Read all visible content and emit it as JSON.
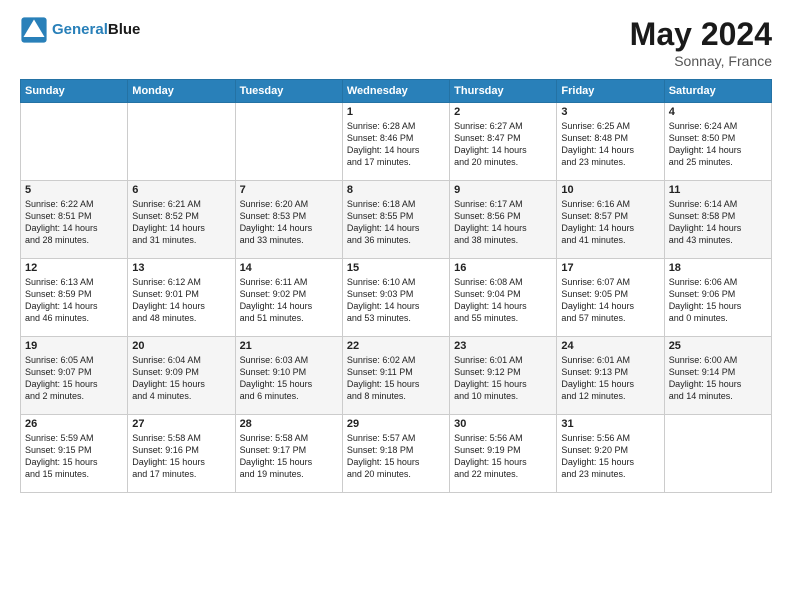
{
  "header": {
    "logo_line1": "General",
    "logo_line2": "Blue",
    "month_year": "May 2024",
    "location": "Sonnay, France"
  },
  "days_of_week": [
    "Sunday",
    "Monday",
    "Tuesday",
    "Wednesday",
    "Thursday",
    "Friday",
    "Saturday"
  ],
  "weeks": [
    [
      {
        "day": "",
        "info": ""
      },
      {
        "day": "",
        "info": ""
      },
      {
        "day": "",
        "info": ""
      },
      {
        "day": "1",
        "info": "Sunrise: 6:28 AM\nSunset: 8:46 PM\nDaylight: 14 hours\nand 17 minutes."
      },
      {
        "day": "2",
        "info": "Sunrise: 6:27 AM\nSunset: 8:47 PM\nDaylight: 14 hours\nand 20 minutes."
      },
      {
        "day": "3",
        "info": "Sunrise: 6:25 AM\nSunset: 8:48 PM\nDaylight: 14 hours\nand 23 minutes."
      },
      {
        "day": "4",
        "info": "Sunrise: 6:24 AM\nSunset: 8:50 PM\nDaylight: 14 hours\nand 25 minutes."
      }
    ],
    [
      {
        "day": "5",
        "info": "Sunrise: 6:22 AM\nSunset: 8:51 PM\nDaylight: 14 hours\nand 28 minutes."
      },
      {
        "day": "6",
        "info": "Sunrise: 6:21 AM\nSunset: 8:52 PM\nDaylight: 14 hours\nand 31 minutes."
      },
      {
        "day": "7",
        "info": "Sunrise: 6:20 AM\nSunset: 8:53 PM\nDaylight: 14 hours\nand 33 minutes."
      },
      {
        "day": "8",
        "info": "Sunrise: 6:18 AM\nSunset: 8:55 PM\nDaylight: 14 hours\nand 36 minutes."
      },
      {
        "day": "9",
        "info": "Sunrise: 6:17 AM\nSunset: 8:56 PM\nDaylight: 14 hours\nand 38 minutes."
      },
      {
        "day": "10",
        "info": "Sunrise: 6:16 AM\nSunset: 8:57 PM\nDaylight: 14 hours\nand 41 minutes."
      },
      {
        "day": "11",
        "info": "Sunrise: 6:14 AM\nSunset: 8:58 PM\nDaylight: 14 hours\nand 43 minutes."
      }
    ],
    [
      {
        "day": "12",
        "info": "Sunrise: 6:13 AM\nSunset: 8:59 PM\nDaylight: 14 hours\nand 46 minutes."
      },
      {
        "day": "13",
        "info": "Sunrise: 6:12 AM\nSunset: 9:01 PM\nDaylight: 14 hours\nand 48 minutes."
      },
      {
        "day": "14",
        "info": "Sunrise: 6:11 AM\nSunset: 9:02 PM\nDaylight: 14 hours\nand 51 minutes."
      },
      {
        "day": "15",
        "info": "Sunrise: 6:10 AM\nSunset: 9:03 PM\nDaylight: 14 hours\nand 53 minutes."
      },
      {
        "day": "16",
        "info": "Sunrise: 6:08 AM\nSunset: 9:04 PM\nDaylight: 14 hours\nand 55 minutes."
      },
      {
        "day": "17",
        "info": "Sunrise: 6:07 AM\nSunset: 9:05 PM\nDaylight: 14 hours\nand 57 minutes."
      },
      {
        "day": "18",
        "info": "Sunrise: 6:06 AM\nSunset: 9:06 PM\nDaylight: 15 hours\nand 0 minutes."
      }
    ],
    [
      {
        "day": "19",
        "info": "Sunrise: 6:05 AM\nSunset: 9:07 PM\nDaylight: 15 hours\nand 2 minutes."
      },
      {
        "day": "20",
        "info": "Sunrise: 6:04 AM\nSunset: 9:09 PM\nDaylight: 15 hours\nand 4 minutes."
      },
      {
        "day": "21",
        "info": "Sunrise: 6:03 AM\nSunset: 9:10 PM\nDaylight: 15 hours\nand 6 minutes."
      },
      {
        "day": "22",
        "info": "Sunrise: 6:02 AM\nSunset: 9:11 PM\nDaylight: 15 hours\nand 8 minutes."
      },
      {
        "day": "23",
        "info": "Sunrise: 6:01 AM\nSunset: 9:12 PM\nDaylight: 15 hours\nand 10 minutes."
      },
      {
        "day": "24",
        "info": "Sunrise: 6:01 AM\nSunset: 9:13 PM\nDaylight: 15 hours\nand 12 minutes."
      },
      {
        "day": "25",
        "info": "Sunrise: 6:00 AM\nSunset: 9:14 PM\nDaylight: 15 hours\nand 14 minutes."
      }
    ],
    [
      {
        "day": "26",
        "info": "Sunrise: 5:59 AM\nSunset: 9:15 PM\nDaylight: 15 hours\nand 15 minutes."
      },
      {
        "day": "27",
        "info": "Sunrise: 5:58 AM\nSunset: 9:16 PM\nDaylight: 15 hours\nand 17 minutes."
      },
      {
        "day": "28",
        "info": "Sunrise: 5:58 AM\nSunset: 9:17 PM\nDaylight: 15 hours\nand 19 minutes."
      },
      {
        "day": "29",
        "info": "Sunrise: 5:57 AM\nSunset: 9:18 PM\nDaylight: 15 hours\nand 20 minutes."
      },
      {
        "day": "30",
        "info": "Sunrise: 5:56 AM\nSunset: 9:19 PM\nDaylight: 15 hours\nand 22 minutes."
      },
      {
        "day": "31",
        "info": "Sunrise: 5:56 AM\nSunset: 9:20 PM\nDaylight: 15 hours\nand 23 minutes."
      },
      {
        "day": "",
        "info": ""
      }
    ]
  ]
}
